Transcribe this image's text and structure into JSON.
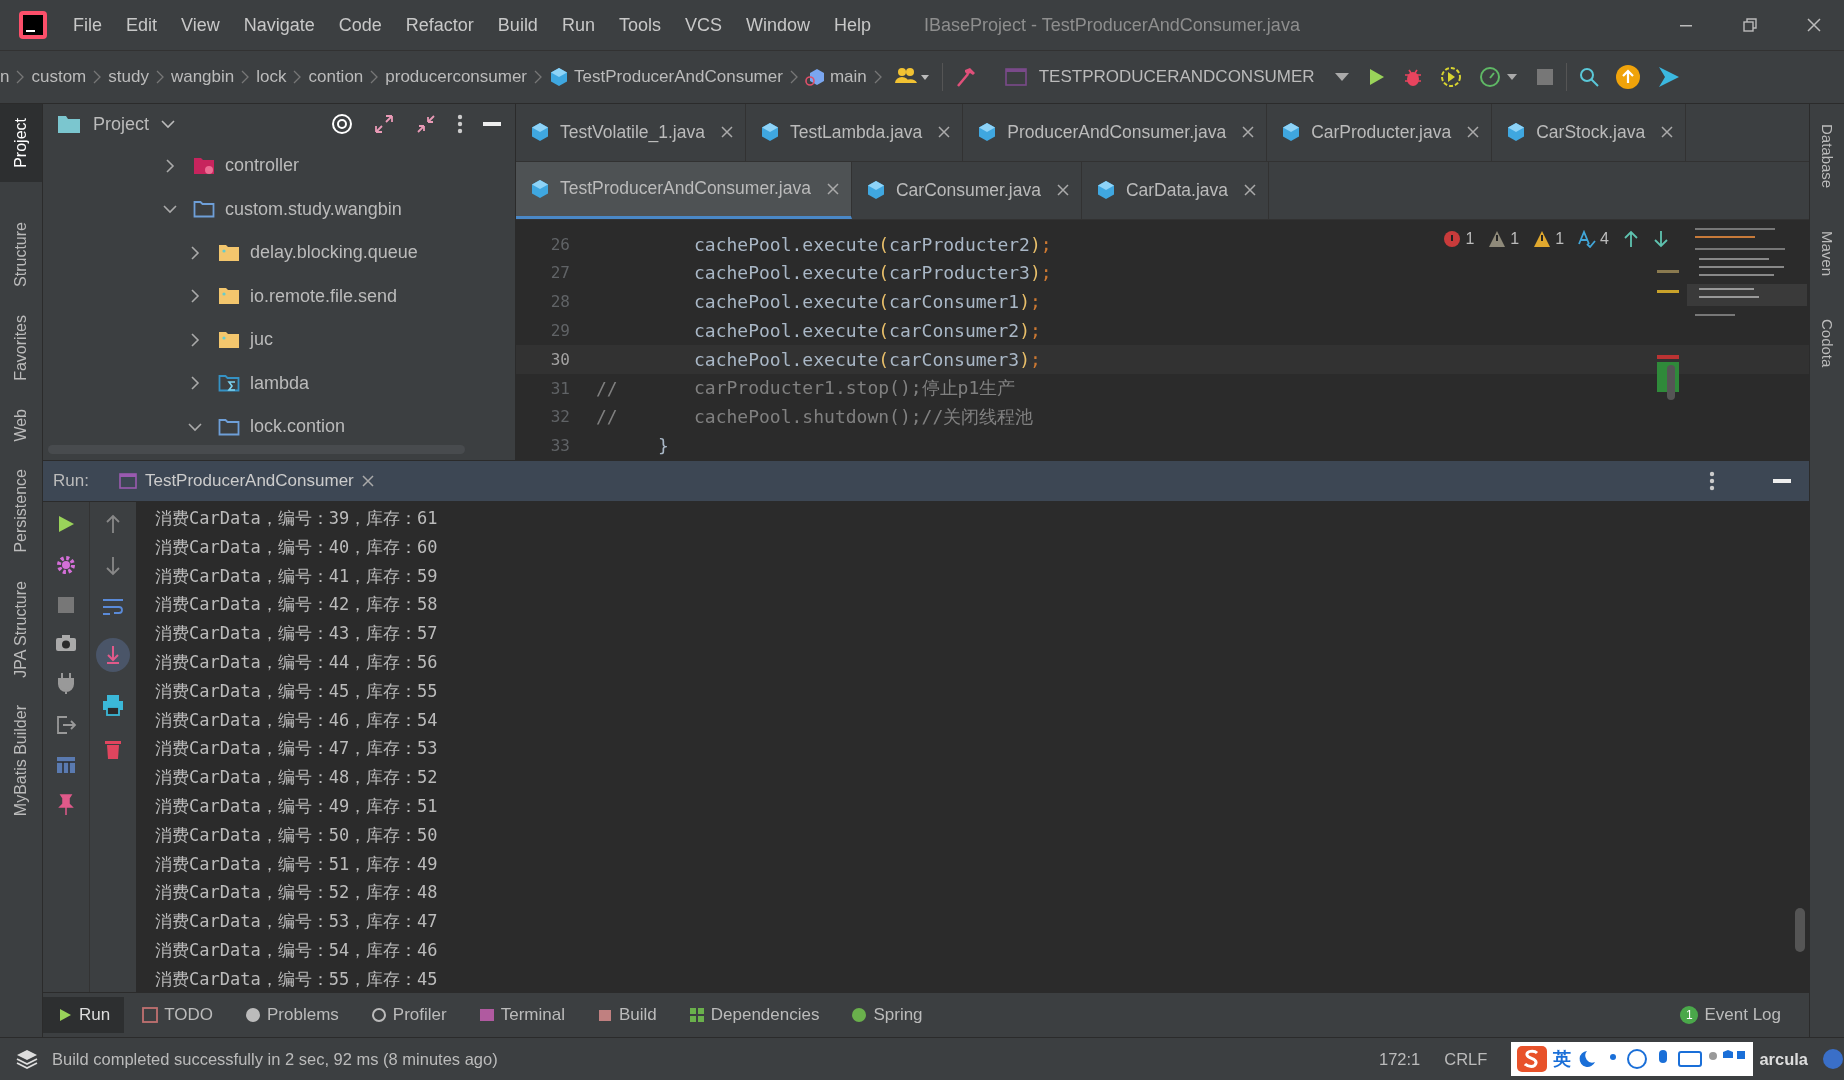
{
  "menu": [
    "File",
    "Edit",
    "View",
    "Navigate",
    "Code",
    "Refactor",
    "Build",
    "Run",
    "Tools",
    "VCS",
    "Window",
    "Help"
  ],
  "window_title": "IBaseProject - TestProducerAndConsumer.java",
  "breadcrumbs": [
    {
      "label": "n",
      "kind": "plain"
    },
    {
      "label": "custom",
      "kind": "plain"
    },
    {
      "label": "study",
      "kind": "plain"
    },
    {
      "label": "wangbin",
      "kind": "plain"
    },
    {
      "label": "lock",
      "kind": "plain"
    },
    {
      "label": "contion",
      "kind": "plain"
    },
    {
      "label": "producerconsumer",
      "kind": "plain"
    },
    {
      "label": "TestProducerAndConsumer",
      "kind": "class"
    },
    {
      "label": "main",
      "kind": "method"
    }
  ],
  "run_config": "TESTPRODUCERANDCONSUMER",
  "left_tools": [
    {
      "label": "Project",
      "selected": true
    },
    {
      "label": "Structure",
      "selected": false
    },
    {
      "label": "Favorites",
      "selected": false
    },
    {
      "label": "Web",
      "selected": false
    },
    {
      "label": "Persistence",
      "selected": false
    },
    {
      "label": "JPA Structure",
      "selected": false
    },
    {
      "label": "MyBatis Builder",
      "selected": false
    }
  ],
  "right_tools": [
    "Database",
    "Maven",
    "Codota"
  ],
  "project_panel": {
    "title": "Project",
    "tree": [
      {
        "label": "controller",
        "kind": "controller",
        "expanded": false
      },
      {
        "label": "custom.study.wangbin",
        "kind": "package",
        "expanded": true,
        "children": [
          {
            "label": "delay.blocking.queue",
            "kind": "folder",
            "expanded": false
          },
          {
            "label": "io.remote.file.send",
            "kind": "folder",
            "expanded": false
          },
          {
            "label": "juc",
            "kind": "folder",
            "expanded": false
          },
          {
            "label": "lambda",
            "kind": "lambda",
            "expanded": false
          },
          {
            "label": "lock.contion",
            "kind": "package",
            "expanded": true
          }
        ]
      }
    ]
  },
  "tab_rows": [
    [
      {
        "label": "TestVolatile_1.java",
        "selected": false
      },
      {
        "label": "TestLambda.java",
        "selected": false
      },
      {
        "label": "ProducerAndConsumer.java",
        "selected": false
      },
      {
        "label": "CarProducter.java",
        "selected": false
      },
      {
        "label": "CarStock.java",
        "selected": false
      }
    ],
    [
      {
        "label": "TestProducerAndConsumer.java",
        "selected": true
      },
      {
        "label": "CarConsumer.java",
        "selected": false
      },
      {
        "label": "CarData.java",
        "selected": false
      }
    ]
  ],
  "inspections": [
    {
      "kind": "error",
      "count": "1"
    },
    {
      "kind": "weak",
      "count": "1"
    },
    {
      "kind": "warning",
      "count": "1"
    },
    {
      "kind": "typo",
      "count": "4"
    }
  ],
  "code_lines": [
    {
      "number": "26",
      "kind": "code",
      "text": "cachePool.execute(carProducter2);",
      "current": false
    },
    {
      "number": "27",
      "kind": "code",
      "text": "cachePool.execute(carProducter3);",
      "current": false
    },
    {
      "number": "28",
      "kind": "code",
      "text": "cachePool.execute(carConsumer1);",
      "current": false
    },
    {
      "number": "29",
      "kind": "code",
      "text": "cachePool.execute(carConsumer2);",
      "current": false
    },
    {
      "number": "30",
      "kind": "code",
      "text": "cachePool.execute(carConsumer3);",
      "current": true
    },
    {
      "number": "31",
      "kind": "comment",
      "marker": "//",
      "text": "carProducter1.stop();停止p1生产",
      "current": false
    },
    {
      "number": "32",
      "kind": "comment",
      "marker": "//",
      "text": "cachePool.shutdown();//关闭线程池",
      "current": false
    },
    {
      "number": "33",
      "kind": "brace",
      "text": "}",
      "current": false
    }
  ],
  "run_panel": {
    "label": "Run:",
    "tab": "TestProducerAndConsumer",
    "console": [
      "消费CarData，编号：39，库存：61",
      "消费CarData，编号：40，库存：60",
      "消费CarData，编号：41，库存：59",
      "消费CarData，编号：42，库存：58",
      "消费CarData，编号：43，库存：57",
      "消费CarData，编号：44，库存：56",
      "消费CarData，编号：45，库存：55",
      "消费CarData，编号：46，库存：54",
      "消费CarData，编号：47，库存：53",
      "消费CarData，编号：48，库存：52",
      "消费CarData，编号：49，库存：51",
      "消费CarData，编号：50，库存：50",
      "消费CarData，编号：51，库存：49",
      "消费CarData，编号：52，库存：48",
      "消费CarData，编号：53，库存：47",
      "消费CarData，编号：54，库存：46",
      "消费CarData，编号：55，库存：45"
    ]
  },
  "tool_tabs": [
    {
      "label": "Run",
      "kind": "run",
      "selected": true
    },
    {
      "label": "TODO",
      "kind": "todo",
      "selected": false
    },
    {
      "label": "Problems",
      "kind": "problems",
      "selected": false
    },
    {
      "label": "Profiler",
      "kind": "profiler",
      "selected": false
    },
    {
      "label": "Terminal",
      "kind": "terminal",
      "selected": false
    },
    {
      "label": "Build",
      "kind": "build",
      "selected": false
    },
    {
      "label": "Dependencies",
      "kind": "deps",
      "selected": false
    },
    {
      "label": "Spring",
      "kind": "spring",
      "selected": false
    }
  ],
  "event_log": {
    "label": "Event Log",
    "badge": "1"
  },
  "status": {
    "message": "Build completed successfully in 2 sec, 92 ms (8 minutes ago)",
    "position": "172:1",
    "line_sep": "CRLF",
    "theme": "arcula"
  },
  "ime_bar": {
    "label": "英"
  }
}
